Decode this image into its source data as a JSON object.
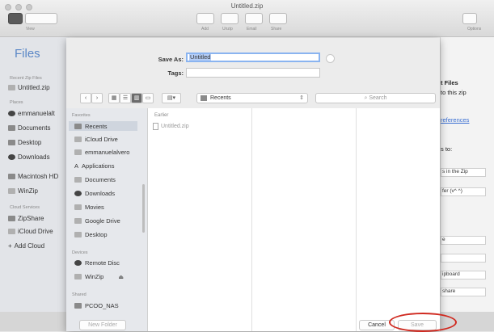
{
  "window": {
    "title": "Untitled.zip"
  },
  "toolbar": {
    "left_label": "View",
    "center_labels": [
      "Add",
      "Unzip",
      "Email",
      "Share"
    ],
    "right_label": "Options",
    "icons": [
      "sidebar-toggle-icon",
      "view-mode-icon",
      "add-icon",
      "unzip-icon",
      "email-icon",
      "share-icon",
      "options-icon"
    ]
  },
  "sidebar": {
    "title": "Files",
    "recent_header": "Recent Zip Files",
    "recent_item": "Untitled.zip",
    "places_header": "Places",
    "places": [
      "emmanuelalt",
      "Documents",
      "Desktop",
      "Downloads",
      "Macintosh HD",
      "WinZip"
    ],
    "cloud_header": "Cloud Services",
    "cloud": [
      "ZipShare",
      "iCloud Drive",
      "Add Cloud"
    ]
  },
  "right_panel": {
    "title": "t Files",
    "sub": "to this zip",
    "link": "references",
    "label_to": "s to:",
    "box1": "s in the Zip",
    "box2": "fer (v^ ^)",
    "box3": "e",
    "box4": "",
    "box5": "ipboard",
    "box6": "share"
  },
  "dialog": {
    "save_as_label": "Save As:",
    "save_as_value": "Untitled",
    "tags_label": "Tags:",
    "tags_value": "",
    "location": "Recents",
    "search_placeholder": "Search",
    "favorites_header": "Favorites",
    "favorites": [
      "Recents",
      "iCloud Drive",
      "emmanuelalvero",
      "Applications",
      "Documents",
      "Downloads",
      "Movies",
      "Google Drive",
      "Desktop"
    ],
    "devices_header": "Devices",
    "devices": [
      "Remote Disc",
      "WinZip"
    ],
    "shared_header": "Shared",
    "shared": [
      "PCOO_NAS"
    ],
    "column_header": "Earlier",
    "column_file": "Untitled.zip",
    "new_folder": "New Folder",
    "cancel": "Cancel",
    "save": "Save"
  },
  "colors": {
    "accent": "#5b87c6",
    "highlight_ring": "#d02a20"
  }
}
